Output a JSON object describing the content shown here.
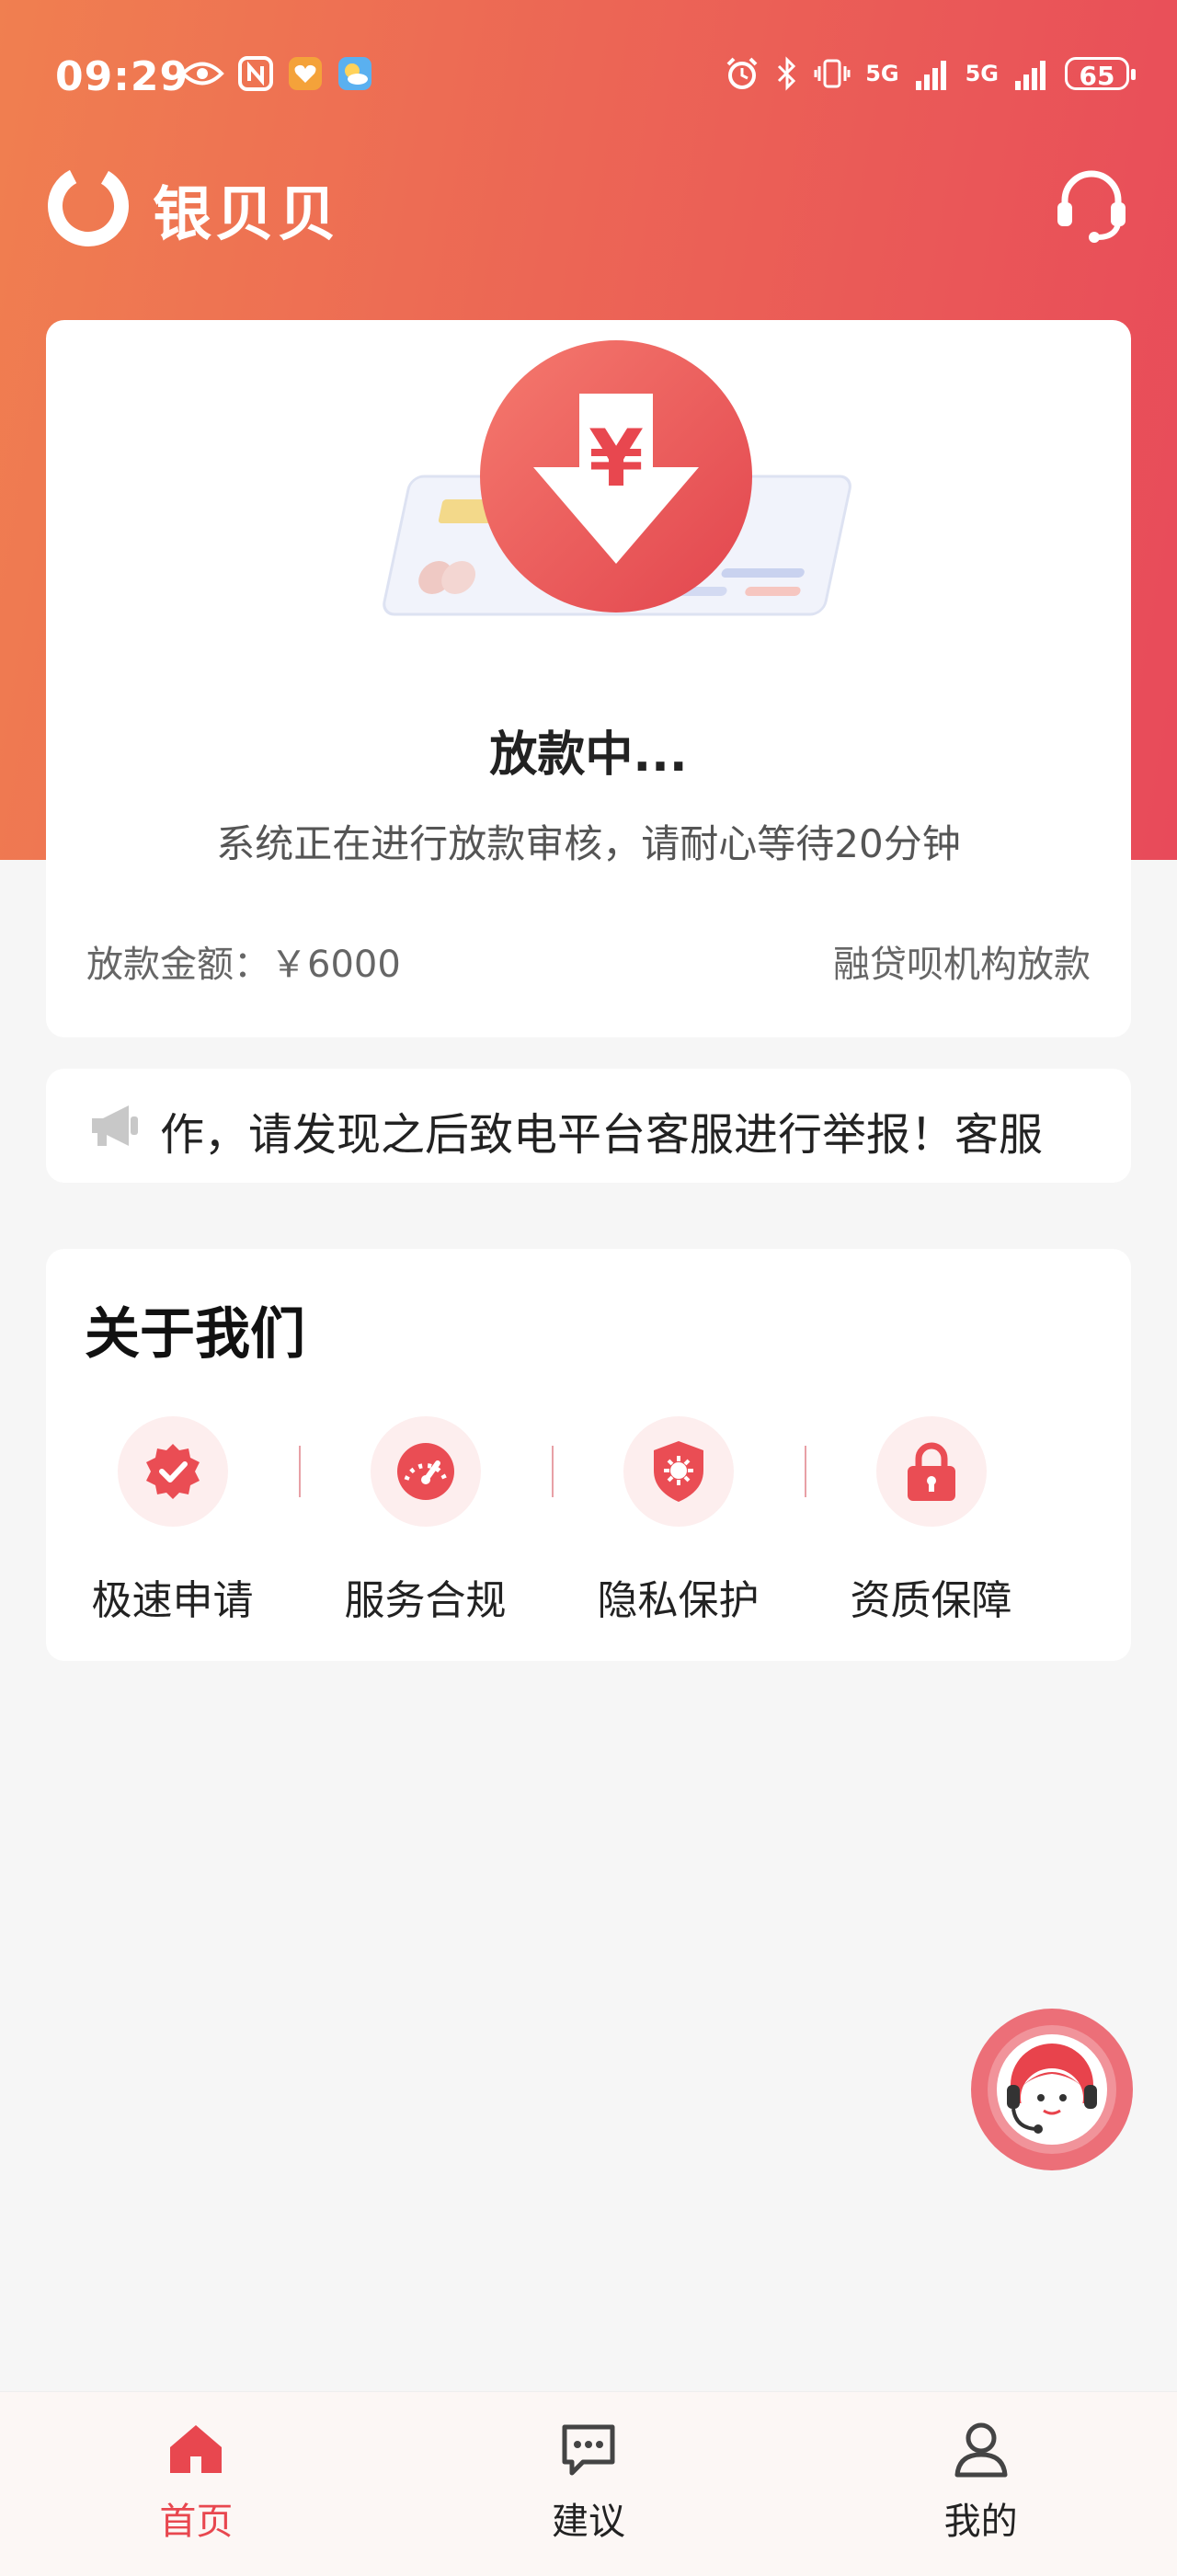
{
  "status_bar": {
    "time": "09:29",
    "battery": "65",
    "signal_1": "5G",
    "signal_2": "5G"
  },
  "header": {
    "app_name": "银贝贝"
  },
  "status_card": {
    "title": "放款中...",
    "description": "系统正在进行放款审核，请耐心等待20分钟",
    "amount_label": "放款金额：",
    "amount_value": "￥6000",
    "lender": "融贷呗机构放款"
  },
  "notice": {
    "text": "作，请发现之后致电平台客服进行举报！客服"
  },
  "about": {
    "title": "关于我们",
    "features": [
      {
        "label": "极速申请",
        "icon": "badge-check-icon"
      },
      {
        "label": "服务合规",
        "icon": "speedometer-icon"
      },
      {
        "label": "隐私保护",
        "icon": "shield-icon"
      },
      {
        "label": "资质保障",
        "icon": "lock-icon"
      }
    ]
  },
  "bottom_nav": {
    "items": [
      {
        "label": "首页",
        "icon": "home-icon",
        "active": true
      },
      {
        "label": "建议",
        "icon": "chat-icon",
        "active": false
      },
      {
        "label": "我的",
        "icon": "user-icon",
        "active": false
      }
    ]
  },
  "colors": {
    "accent": "#e8474f",
    "gradient_start": "#f07f50",
    "gradient_end": "#e84a5a",
    "background": "#f6f6f6"
  }
}
